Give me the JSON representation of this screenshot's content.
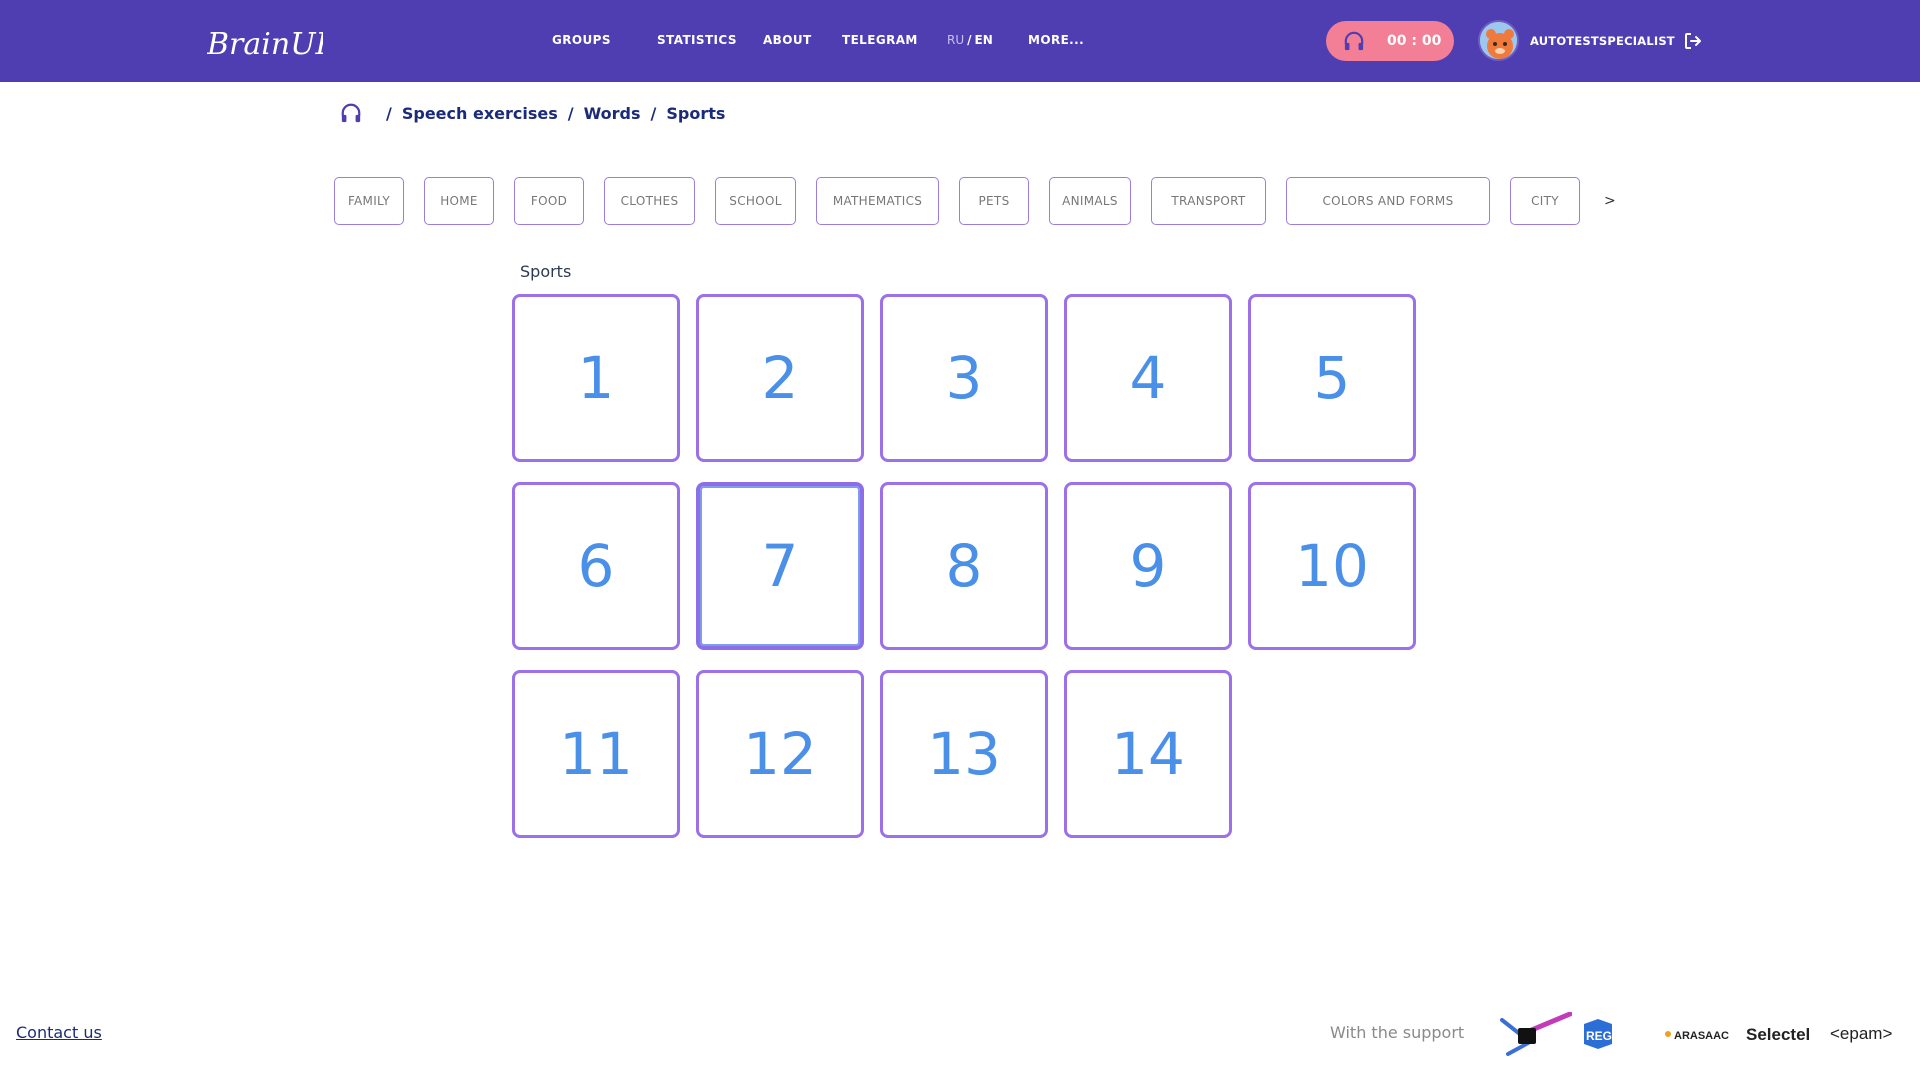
{
  "header": {
    "logo_text": "BrainUP",
    "nav": [
      "GROUPS",
      "STATISTICS",
      "ABOUT",
      "TELEGRAM",
      "MORE..."
    ],
    "lang": {
      "ru": "RU",
      "sep": "/",
      "en": "EN"
    },
    "timer": "00 : 00",
    "username": "AUTOTESTSPECIALIST"
  },
  "breadcrumb": [
    "Speech exercises",
    "Words",
    "Sports"
  ],
  "groups": [
    "FAMILY",
    "HOME",
    "FOOD",
    "CLOTHES",
    "SCHOOL",
    "MATHEMATICS",
    "PETS",
    "ANIMALS",
    "TRANSPORT",
    "COLORS AND FORMS",
    "CITY"
  ],
  "groups_next": ">",
  "series_title": "Sports",
  "exercises": [
    "1",
    "2",
    "3",
    "4",
    "5",
    "6",
    "7",
    "8",
    "9",
    "10",
    "11",
    "12",
    "13",
    "14"
  ],
  "active_exercise": "7",
  "footer": {
    "contact": "Contact us",
    "support": "With the support",
    "sponsors": [
      "REG.RU",
      "ARASAAC",
      "Selectel",
      "<epam>"
    ]
  },
  "colors": {
    "header_bg": "#4f3db2",
    "timer_bg": "#f27f95",
    "card_border": "#9b70e8",
    "card_number": "#4a8fe8",
    "breadcrumb": "#1b2a7a"
  }
}
